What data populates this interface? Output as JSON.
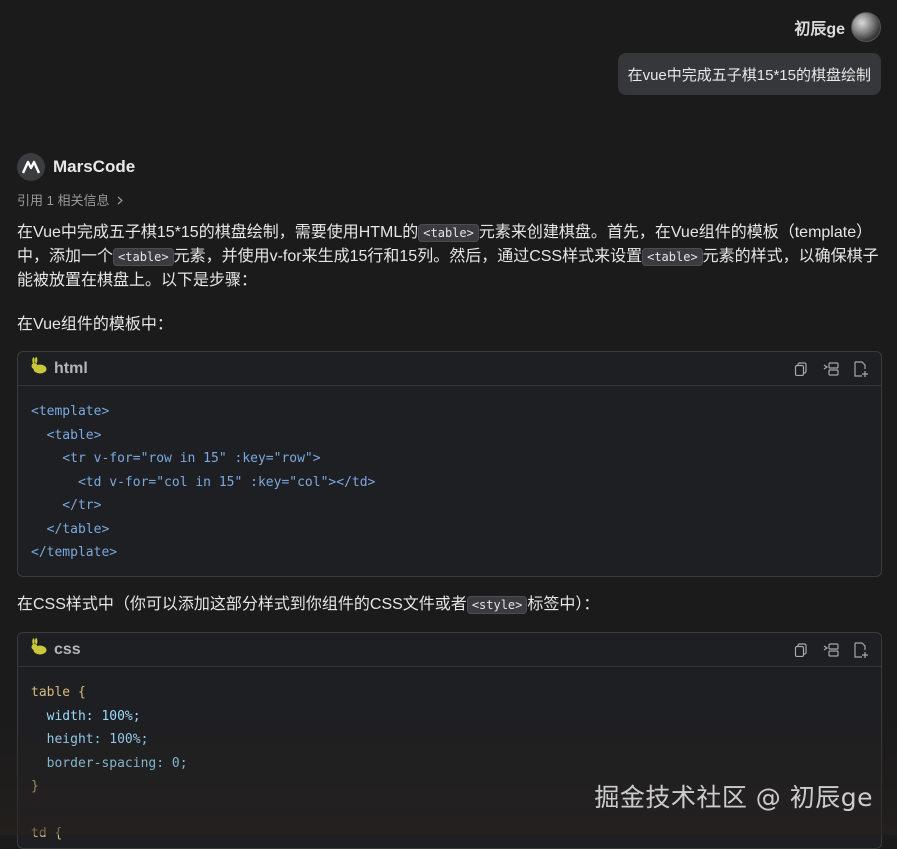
{
  "user": {
    "name": "初辰ge",
    "message": "在vue中完成五子棋15*15的棋盘绘制"
  },
  "assistant": {
    "name": "MarsCode",
    "refs": "引用 1 相关信息",
    "p1_a": "在Vue中完成五子棋15*15的棋盘绘制，需要使用HTML的",
    "p1_code1": "<table>",
    "p1_b": "元素来创建棋盘。首先，在Vue组件的模板（template）中，添加一个",
    "p1_code2": "<table>",
    "p1_c": "元素，并使用v-for来生成15行和15列。然后，通过CSS样式来设置",
    "p1_code3": "<table>",
    "p1_d": "元素的样式，以确保棋子能被放置在棋盘上。以下是步骤：",
    "p2": "在Vue组件的模板中：",
    "p3_a": "在CSS样式中（你可以添加这部分样式到你组件的CSS文件或者",
    "p3_code": "<style>",
    "p3_b": "标签中）："
  },
  "code_blocks": [
    {
      "lang": "html",
      "lines": [
        [
          "<template>"
        ],
        [
          "  <table>"
        ],
        [
          "    <tr v-for=\"row in 15\" :key=\"row\">"
        ],
        [
          "      <td v-for=\"col in 15\" :key=\"col\"></td>"
        ],
        [
          "    </tr>"
        ],
        [
          "  </table>"
        ],
        [
          "</template>"
        ]
      ]
    },
    {
      "lang": "css",
      "lines": [
        [
          "table {"
        ],
        [
          "  width: 100%;"
        ],
        [
          "  height: 100%;"
        ],
        [
          "  border-spacing: 0;"
        ],
        [
          "}"
        ],
        [
          ""
        ],
        [
          "td {"
        ]
      ]
    }
  ],
  "tools": [
    "copy-icon",
    "insert-icon",
    "new-file-icon"
  ],
  "watermark": "掘金技术社区 @ 初辰ge"
}
